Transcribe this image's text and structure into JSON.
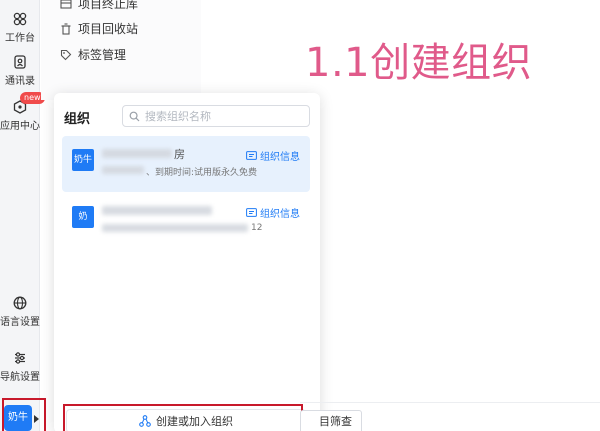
{
  "rail": {
    "items": [
      {
        "label": "工作台",
        "icon": "workbench-icon"
      },
      {
        "label": "通讯录",
        "icon": "contacts-icon"
      },
      {
        "label": "应用中心",
        "icon": "app-center-icon",
        "badge": "new"
      },
      {
        "label": "语言设置",
        "icon": "globe-icon"
      },
      {
        "label": "导航设置",
        "icon": "sliders-icon"
      }
    ],
    "avatar": "奶牛"
  },
  "project_menu": {
    "items": [
      {
        "label": "项目终止库",
        "icon": "archive-icon"
      },
      {
        "label": "项目回收站",
        "icon": "trash-icon"
      },
      {
        "label": "标签管理",
        "icon": "tag-icon"
      }
    ]
  },
  "org_panel": {
    "title": "组织",
    "search_placeholder": "搜索组织名称",
    "orgs": [
      {
        "logo": "奶牛",
        "name_suffix": "房",
        "sub": "、到期时间:试用版永久免费",
        "info_label": "组织信息",
        "selected": true
      },
      {
        "logo": "奶",
        "name_suffix": "",
        "sub": "12",
        "info_label": "组织信息",
        "selected": false
      }
    ],
    "create_label": "创建或加入组织"
  },
  "annotation": "1.1创建组织",
  "filter_button": "目筛查",
  "colors": {
    "accent": "#1f7bf5",
    "annotation": "#e05a8a",
    "highlight": "#c8192b"
  }
}
